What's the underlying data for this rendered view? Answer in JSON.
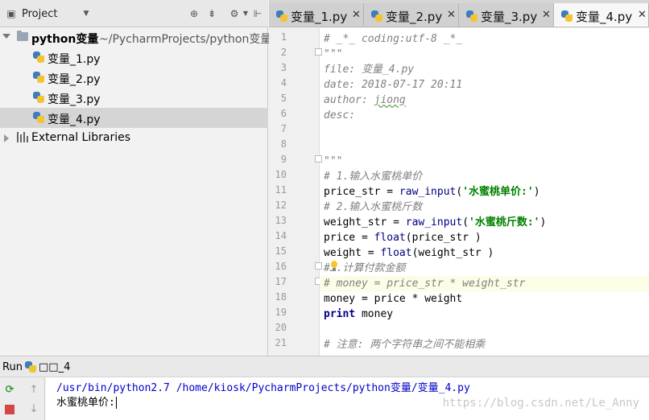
{
  "project_panel": {
    "title": "Project",
    "root": {
      "name": "python变量",
      "path": "~/PycharmProjects/python变量"
    },
    "files": [
      "变量_1.py",
      "变量_2.py",
      "变量_3.py",
      "变量_4.py"
    ],
    "selected_file": "变量_4.py",
    "external_libraries": "External Libraries"
  },
  "editor_tabs": [
    {
      "label": "变量_1.py",
      "active": false
    },
    {
      "label": "变量_2.py",
      "active": false
    },
    {
      "label": "变量_3.py",
      "active": false
    },
    {
      "label": "变量_4.py",
      "active": true
    }
  ],
  "editor": {
    "line_numbers": [
      "1",
      "2",
      "3",
      "4",
      "5",
      "6",
      "7",
      "8",
      "9",
      "10",
      "11",
      "12",
      "13",
      "14",
      "15",
      "16",
      "17",
      "18",
      "19",
      "20",
      "21"
    ],
    "current_line": "17",
    "code": {
      "l1": "# _*_ coding:utf-8 _*_",
      "l2": "\"\"\"",
      "l3": "file: 变量_4.py",
      "l4": "date: 2018-07-17 20:11",
      "l5_prefix": "author: ",
      "l5_name": "jiong",
      "l6": "desc:",
      "l9": "\"\"\"",
      "l10": "# 1.输入水蜜桃单价",
      "l11_a": "price_str = ",
      "l11_fn": "raw_input",
      "l11_str": "'水蜜桃单价:'",
      "l11_b": ")",
      "l12": "# 2.输入水蜜桃斤数",
      "l13_a": "weight_str = ",
      "l13_fn": "raw_input",
      "l13_str": "'水蜜桃斤数:'",
      "l13_b": ")",
      "l14_a": "price = ",
      "l14_fn": "float",
      "l14_b": "(price_str",
      "l14_c": " )",
      "l15_a": "weight = ",
      "l15_fn": "float",
      "l15_b": "(weight_str",
      "l15_c": " )",
      "l16": "#3.计算付款金额",
      "l17": "# money = price_str * weight_str",
      "l18": "money = price * weight",
      "l19_kw": "print",
      "l19_rest": " money",
      "l21": "# 注意: 两个字符串之间不能相乘"
    }
  },
  "run_panel": {
    "label": "Run",
    "config_name": "□□_4",
    "command_line": "/usr/bin/python2.7 /home/kiosk/PycharmProjects/python变量/变量_4.py",
    "prompt": "水蜜桃单价:"
  },
  "watermark": "https://blog.csdn.net/Le_Anny",
  "colors": {
    "comment": "#808080",
    "string": "#008000",
    "builtin": "#000080",
    "console_command": "#0000cc",
    "selection": "#d5d5d5",
    "current_line": "#fdfce6"
  }
}
